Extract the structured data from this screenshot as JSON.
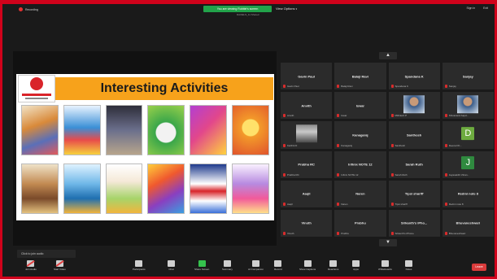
{
  "window": {
    "recording_label": "Recording",
    "share_banner": "You are viewing Rubble's screen",
    "share_sub": "DAOELS_11 Shared",
    "view_options": "View Options",
    "top_right": [
      "Sign in",
      "Exit"
    ]
  },
  "slide": {
    "title": "Interesting Activities",
    "colors": {
      "band": "#f7a21b",
      "logo_red": "#d9242a"
    }
  },
  "gallery": {
    "nav_up": "▲",
    "nav_down": "▼",
    "tiles": [
      {
        "name": "Gavin Paul",
        "sub": "Gavin Paul"
      },
      {
        "name": "Balaji Ravi",
        "sub": "Balaji Ravi"
      },
      {
        "name": "Spandana K",
        "sub": "Spandana K"
      },
      {
        "name": "Sanjay",
        "sub": "Sanjay"
      },
      {
        "name": "Anvith",
        "sub": "Anvith"
      },
      {
        "name": "Iswar",
        "sub": "Iswar"
      },
      {
        "name": "",
        "sub": "Mithilesh P",
        "kind": "photo",
        "photo": "person-photo"
      },
      {
        "name": "",
        "sub": "Shivanand Aapd...",
        "kind": "photo",
        "photo": "person-photo"
      },
      {
        "name": "",
        "sub": "Karthik D",
        "kind": "photo",
        "photo": "group-photo"
      },
      {
        "name": "Kanagaraj",
        "sub": "Kanagaraj"
      },
      {
        "name": "Santhosh",
        "sub": "Santhosh"
      },
      {
        "name": "",
        "sub": "Deena Dh...",
        "kind": "avatar",
        "initial": "D",
        "color": "#6dab3f"
      },
      {
        "name": "Prabha RC",
        "sub": "Prabha RC"
      },
      {
        "name": "Infinix NOTE 12",
        "sub": "Infinix NOTE 12"
      },
      {
        "name": "Sarah Ruth",
        "sub": "Sarah Ruth"
      },
      {
        "name": "",
        "sub": "Jayasakthi Vitran...",
        "kind": "avatar",
        "initial": "J",
        "color": "#2f8a3f"
      },
      {
        "name": "Aaqil",
        "sub": "Aaqil"
      },
      {
        "name": "Naren",
        "sub": "Naren"
      },
      {
        "name": "Tipsi shariff",
        "sub": "Tipsi shariff"
      },
      {
        "name": "Redmi note 8",
        "sub": "Redmi note 8"
      },
      {
        "name": "Vinoth",
        "sub": "Vinoth"
      },
      {
        "name": "Prabhu",
        "sub": "Prabhu"
      },
      {
        "name": "Srikanth's iPho...",
        "sub": "Srikanth's iPhone"
      },
      {
        "name": "Bhuvaneshwari",
        "sub": "Bhuvaneshwari"
      }
    ]
  },
  "chat_toast": "Click to join audio",
  "toolbar": {
    "items": [
      {
        "label": "Join Audio",
        "icon": "headphone-icon"
      },
      {
        "label": "Start Video",
        "icon": "video-icon"
      },
      {
        "label": "Participants",
        "icon": "participants-icon"
      },
      {
        "label": "Chat",
        "icon": "chat-icon"
      },
      {
        "label": "Share Screen",
        "icon": "share-screen-icon"
      },
      {
        "label": "Summary",
        "icon": "summary-icon"
      },
      {
        "label": "AI Companion",
        "icon": "ai-companion-icon"
      },
      {
        "label": "Record",
        "icon": "record-icon"
      },
      {
        "label": "Show Captions",
        "icon": "captions-icon"
      },
      {
        "label": "Reactions",
        "icon": "reactions-icon"
      },
      {
        "label": "Apps",
        "icon": "apps-icon"
      },
      {
        "label": "Whiteboards",
        "icon": "whiteboard-icon"
      },
      {
        "label": "Notes",
        "icon": "notes-icon"
      }
    ],
    "end_label": "Leave"
  }
}
